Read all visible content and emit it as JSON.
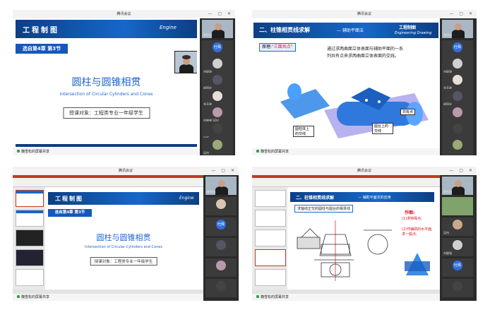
{
  "meeting_title": "腾讯会议",
  "share_status": "魏雪松的屏幕共享",
  "colors": {
    "sidebar_bg": "#2b2b2b",
    "banner": "#1667c9",
    "accent_blue": "#2266cc"
  },
  "q1": {
    "banner_title": "工程制图",
    "banner_eng": "Engine",
    "chapter": "选自第4章 第3节",
    "main_title": "圆柱与圆锥相贯",
    "subtitle": "Intersection of Circular Cylinders and Cones",
    "audience": "授课对象：工程类专业一年级学生",
    "participants": [
      {
        "name": "魏雪松",
        "avatar": ""
      },
      {
        "name": "",
        "avatar": "吐辉"
      },
      {
        "name": "刘聪瑞",
        "avatar": ""
      },
      {
        "name": "郝国庆",
        "avatar": ""
      },
      {
        "name": "张芳晓",
        "avatar": ""
      },
      {
        "name": "刘晓晓 SDU",
        "avatar": ""
      },
      {
        "name": "ssst",
        "avatar": ""
      },
      {
        "name": "吴伟",
        "avatar": ""
      }
    ]
  },
  "q2": {
    "banner_title": "二、柱锥相贯线求解",
    "banner_sub": "— 辅助平面法",
    "banner_course": "工程制图",
    "banner_eng": "Engineering Drawing",
    "principle_label": "原理:",
    "principle_value": "\"三面共点\"",
    "explanation_1": "通过求两曲面立体表面与辅助平面的一系",
    "explanation_2": "列共有点来求两曲面立体表面的交线。",
    "label_common": "共有点",
    "label_cyl": "圆柱体上的交线",
    "label_cone": "圆台上的交线",
    "participants": [
      {
        "name": "魏雪松",
        "avatar": ""
      },
      {
        "name": "",
        "avatar": "吐辉"
      },
      {
        "name": "刘聪瑞",
        "avatar": ""
      },
      {
        "name": "张芳晓",
        "avatar": ""
      },
      {
        "name": "郝国庆",
        "avatar": ""
      },
      {
        "name": "",
        "avatar": ""
      },
      {
        "name": "",
        "avatar": ""
      }
    ]
  },
  "q3": {
    "banner_title": "工程制图",
    "banner_eng": "Engine",
    "chapter": "选自第4章 第3节",
    "main_title": "圆柱与圆锥相贯",
    "subtitle": "Intersection of Circular Cylinders and Cones",
    "audience": "授课对象：工程类专业一年级学生",
    "participants": [
      {
        "name": "魏雪松",
        "avatar": ""
      },
      {
        "name": "",
        "avatar": ""
      },
      {
        "name": "",
        "avatar": "吐辉"
      },
      {
        "name": "",
        "avatar": ""
      },
      {
        "name": "",
        "avatar": ""
      },
      {
        "name": "",
        "avatar": ""
      }
    ]
  },
  "q4": {
    "banner_title": "二、柱锥相贯线求解",
    "banner_sub": "— 辅助平面法的应用",
    "example_title": "求轴线正交的圆柱与圆台的相贯线",
    "steps_title": "作图:",
    "step1": "(1)求特殊点;",
    "step2": "(2)作辅助的水平面,求一般点;",
    "participants": [
      {
        "name": "魏雪松",
        "avatar": ""
      },
      {
        "name": "",
        "avatar": ""
      },
      {
        "name": "吴伟",
        "avatar": ""
      },
      {
        "name": "刘聪瑞",
        "avatar": ""
      },
      {
        "name": "",
        "avatar": "吐辉"
      },
      {
        "name": "",
        "avatar": ""
      }
    ]
  }
}
